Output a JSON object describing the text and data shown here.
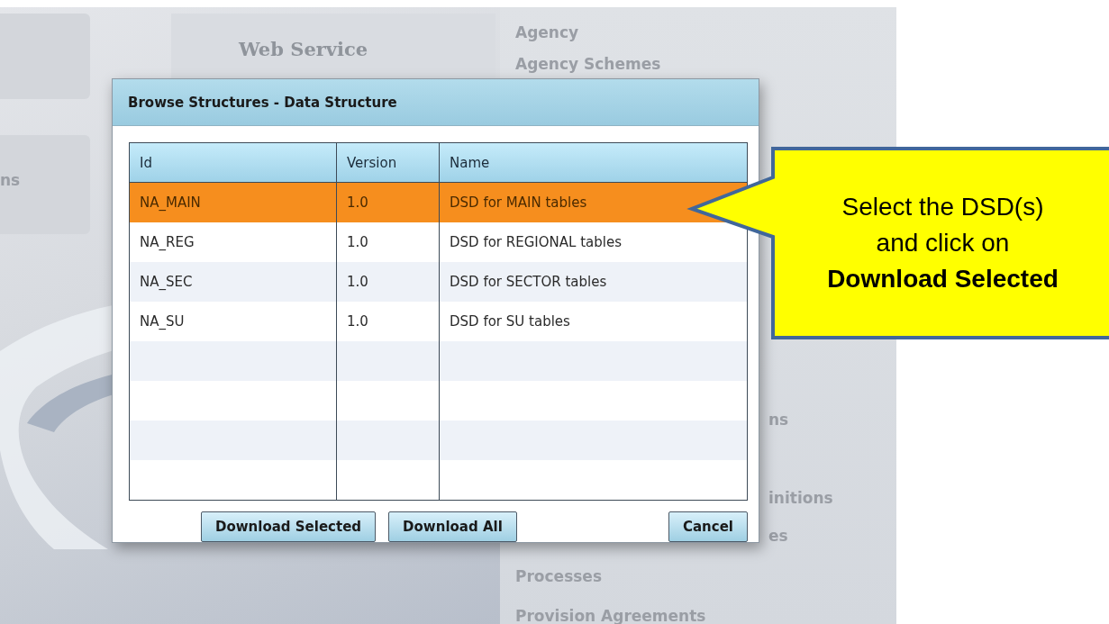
{
  "background": {
    "tile_label": "Web Service",
    "left_fragment": "ns",
    "menu_top": [
      "Agency",
      "Agency Schemes"
    ],
    "menu_fragments": [
      "ns",
      "initions",
      "es"
    ],
    "menu_bottom": [
      "Processes",
      "Provision Agreements"
    ]
  },
  "dialog": {
    "title": "Browse Structures - Data Structure",
    "table": {
      "columns": [
        "Id",
        "Version",
        "Name"
      ],
      "rows": [
        {
          "cells": [
            "NA_MAIN",
            "1.0",
            "DSD for MAIN tables"
          ],
          "selected": true
        },
        {
          "cells": [
            "NA_REG",
            "1.0",
            "DSD for REGIONAL tables"
          ],
          "selected": false
        },
        {
          "cells": [
            "NA_SEC",
            "1.0",
            "DSD for SECTOR tables"
          ],
          "selected": false
        },
        {
          "cells": [
            "NA_SU",
            "1.0",
            "DSD for SU tables"
          ],
          "selected": false
        }
      ]
    },
    "buttons": [
      {
        "label": "Download Selected",
        "kind": "left"
      },
      {
        "label": "Download All",
        "kind": "left"
      },
      {
        "label": "Cancel",
        "kind": "right"
      }
    ]
  },
  "callout": {
    "lines": [
      "Select the DSD(s)",
      "and click on",
      "**Download Selected**"
    ]
  }
}
